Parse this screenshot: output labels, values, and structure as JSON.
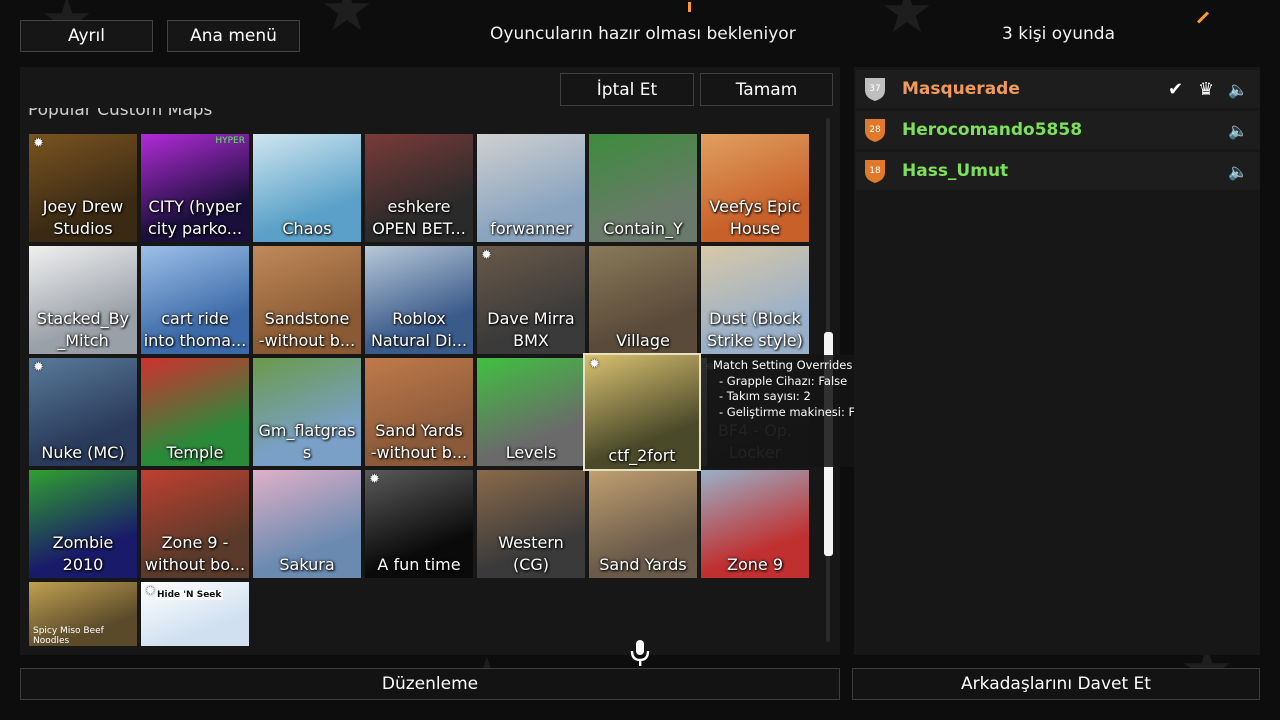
{
  "header": {
    "leave_label": "Ayrıl",
    "main_menu_label": "Ana menü",
    "status_text": "Oyuncuların hazır olması bekleniyor",
    "player_count_text": "3 kişi oyunda"
  },
  "map_panel": {
    "cancel_label": "İptal Et",
    "ok_label": "Tamam",
    "section_title": "Popular Custom Maps",
    "maps": [
      {
        "name": "Joey Drew Studios",
        "lines": [
          "Joey Drew",
          "Studios"
        ],
        "settings": true
      },
      {
        "name": "CITY (hyper city parko...",
        "lines": [
          "CITY (hyper",
          "city parko..."
        ],
        "thumb_text": "HYPER"
      },
      {
        "name": "Chaos",
        "lines": [
          "Chaos"
        ]
      },
      {
        "name": "eshkere OPEN BET...",
        "lines": [
          "eshkere",
          "OPEN BET..."
        ]
      },
      {
        "name": "forwanner",
        "lines": [
          "forwanner"
        ]
      },
      {
        "name": "Contain_Y",
        "lines": [
          "Contain_Y"
        ]
      },
      {
        "name": "Veefys Epic House",
        "lines": [
          "Veefys Epic",
          "House"
        ]
      },
      {
        "name": "Stacked_By_Mitch",
        "lines": [
          "Stacked_By",
          "_Mitch"
        ]
      },
      {
        "name": "cart ride into thoma...",
        "lines": [
          "cart ride",
          "into thoma..."
        ]
      },
      {
        "name": "Sandstone -without b...",
        "lines": [
          "Sandstone",
          "-without b..."
        ]
      },
      {
        "name": "Roblox Natural Di...",
        "lines": [
          "Roblox",
          "Natural Di..."
        ]
      },
      {
        "name": "Dave Mirra BMX",
        "lines": [
          "Dave Mirra",
          "BMX"
        ],
        "settings": true
      },
      {
        "name": "Village",
        "lines": [
          "Village"
        ]
      },
      {
        "name": "Dust (Block Strike style)",
        "lines": [
          "Dust (Block",
          "Strike style)"
        ]
      },
      {
        "name": "Nuke (MC)",
        "lines": [
          "Nuke (MC)"
        ],
        "settings": true
      },
      {
        "name": "Temple",
        "lines": [
          "Temple"
        ]
      },
      {
        "name": "Gm_flatgrass",
        "lines": [
          "Gm_flatgras",
          "s"
        ]
      },
      {
        "name": "Sand Yards -without b...",
        "lines": [
          "Sand Yards",
          "-without b..."
        ]
      },
      {
        "name": "Levels",
        "lines": [
          "Levels"
        ]
      },
      {
        "name": "ctf_2fort",
        "lines": [
          "ctf_2fort"
        ],
        "settings": true,
        "selected": true
      },
      {
        "name": "BF4 - Op. Locker",
        "lines": [
          "BF4 - Op.",
          "Locker"
        ],
        "settings": true
      },
      {
        "name": "Zombie 2010",
        "lines": [
          "Zombie",
          "2010"
        ]
      },
      {
        "name": "Zone 9 - without bo...",
        "lines": [
          "Zone 9 -",
          "without bo..."
        ]
      },
      {
        "name": "Sakura",
        "lines": [
          "Sakura"
        ]
      },
      {
        "name": "A fun time",
        "lines": [
          "A fun time"
        ],
        "settings": true
      },
      {
        "name": "Western (CG)",
        "lines": [
          "Western",
          "(CG)"
        ]
      },
      {
        "name": "Sand Yards",
        "lines": [
          "Sand Yards"
        ]
      },
      {
        "name": "Zone 9",
        "lines": [
          "Zone 9"
        ]
      },
      {
        "name": "Spicy Miso Beef Noodles",
        "lines": [],
        "thumb_text": "Spicy Miso Beef Noodles"
      },
      {
        "name": "Hide 'N Seek",
        "lines": [],
        "settings": true,
        "thumb_text": "Hide 'N Seek"
      }
    ],
    "tooltip": {
      "title": "Match Setting Overrides",
      "lines": [
        "- Grapple Cihazı: False",
        "- Takım sayısı: 2",
        "- Geliştirme makinesi: False"
      ]
    }
  },
  "players": [
    {
      "name": "Masquerade",
      "level": "37",
      "name_color": "#f29a5c",
      "badge_color": "#bfbfbf",
      "ready": true,
      "host": true
    },
    {
      "name": "Herocomando5858",
      "level": "28",
      "name_color": "#7ee05a",
      "badge_color": "#e07a2a",
      "ready": false,
      "host": false
    },
    {
      "name": "Hass_Umut",
      "level": "18",
      "name_color": "#7ee05a",
      "badge_color": "#e07a2a",
      "ready": false,
      "host": false
    }
  ],
  "footer": {
    "edit_label": "Düzenleme",
    "invite_label": "Arkadaşlarını Davet Et"
  },
  "icons": {
    "settings": "gear-icon",
    "ready": "checkmark-icon",
    "host": "crown-icon",
    "mute": "speaker-icon",
    "mic": "microphone-icon"
  }
}
